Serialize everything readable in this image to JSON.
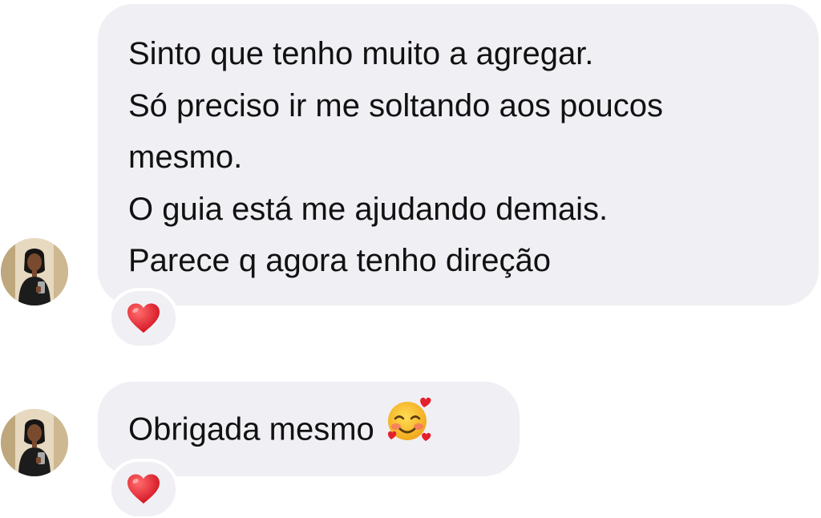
{
  "thread": {
    "messages": [
      {
        "lines": [
          "Sinto que tenho muito a agregar.",
          "Só preciso ir me soltando aos poucos",
          "mesmo.",
          "O guia está me ajudando demais.",
          "Parece q agora tenho direção"
        ],
        "reaction": "red-heart"
      },
      {
        "text": "Obrigada mesmo",
        "emoji": "smiling-face-with-hearts",
        "reaction": "red-heart"
      }
    ]
  },
  "colors": {
    "bubble_bg": "#efeff4",
    "text": "#111111",
    "heart": "#e4202e",
    "page_bg": "#ffffff"
  }
}
